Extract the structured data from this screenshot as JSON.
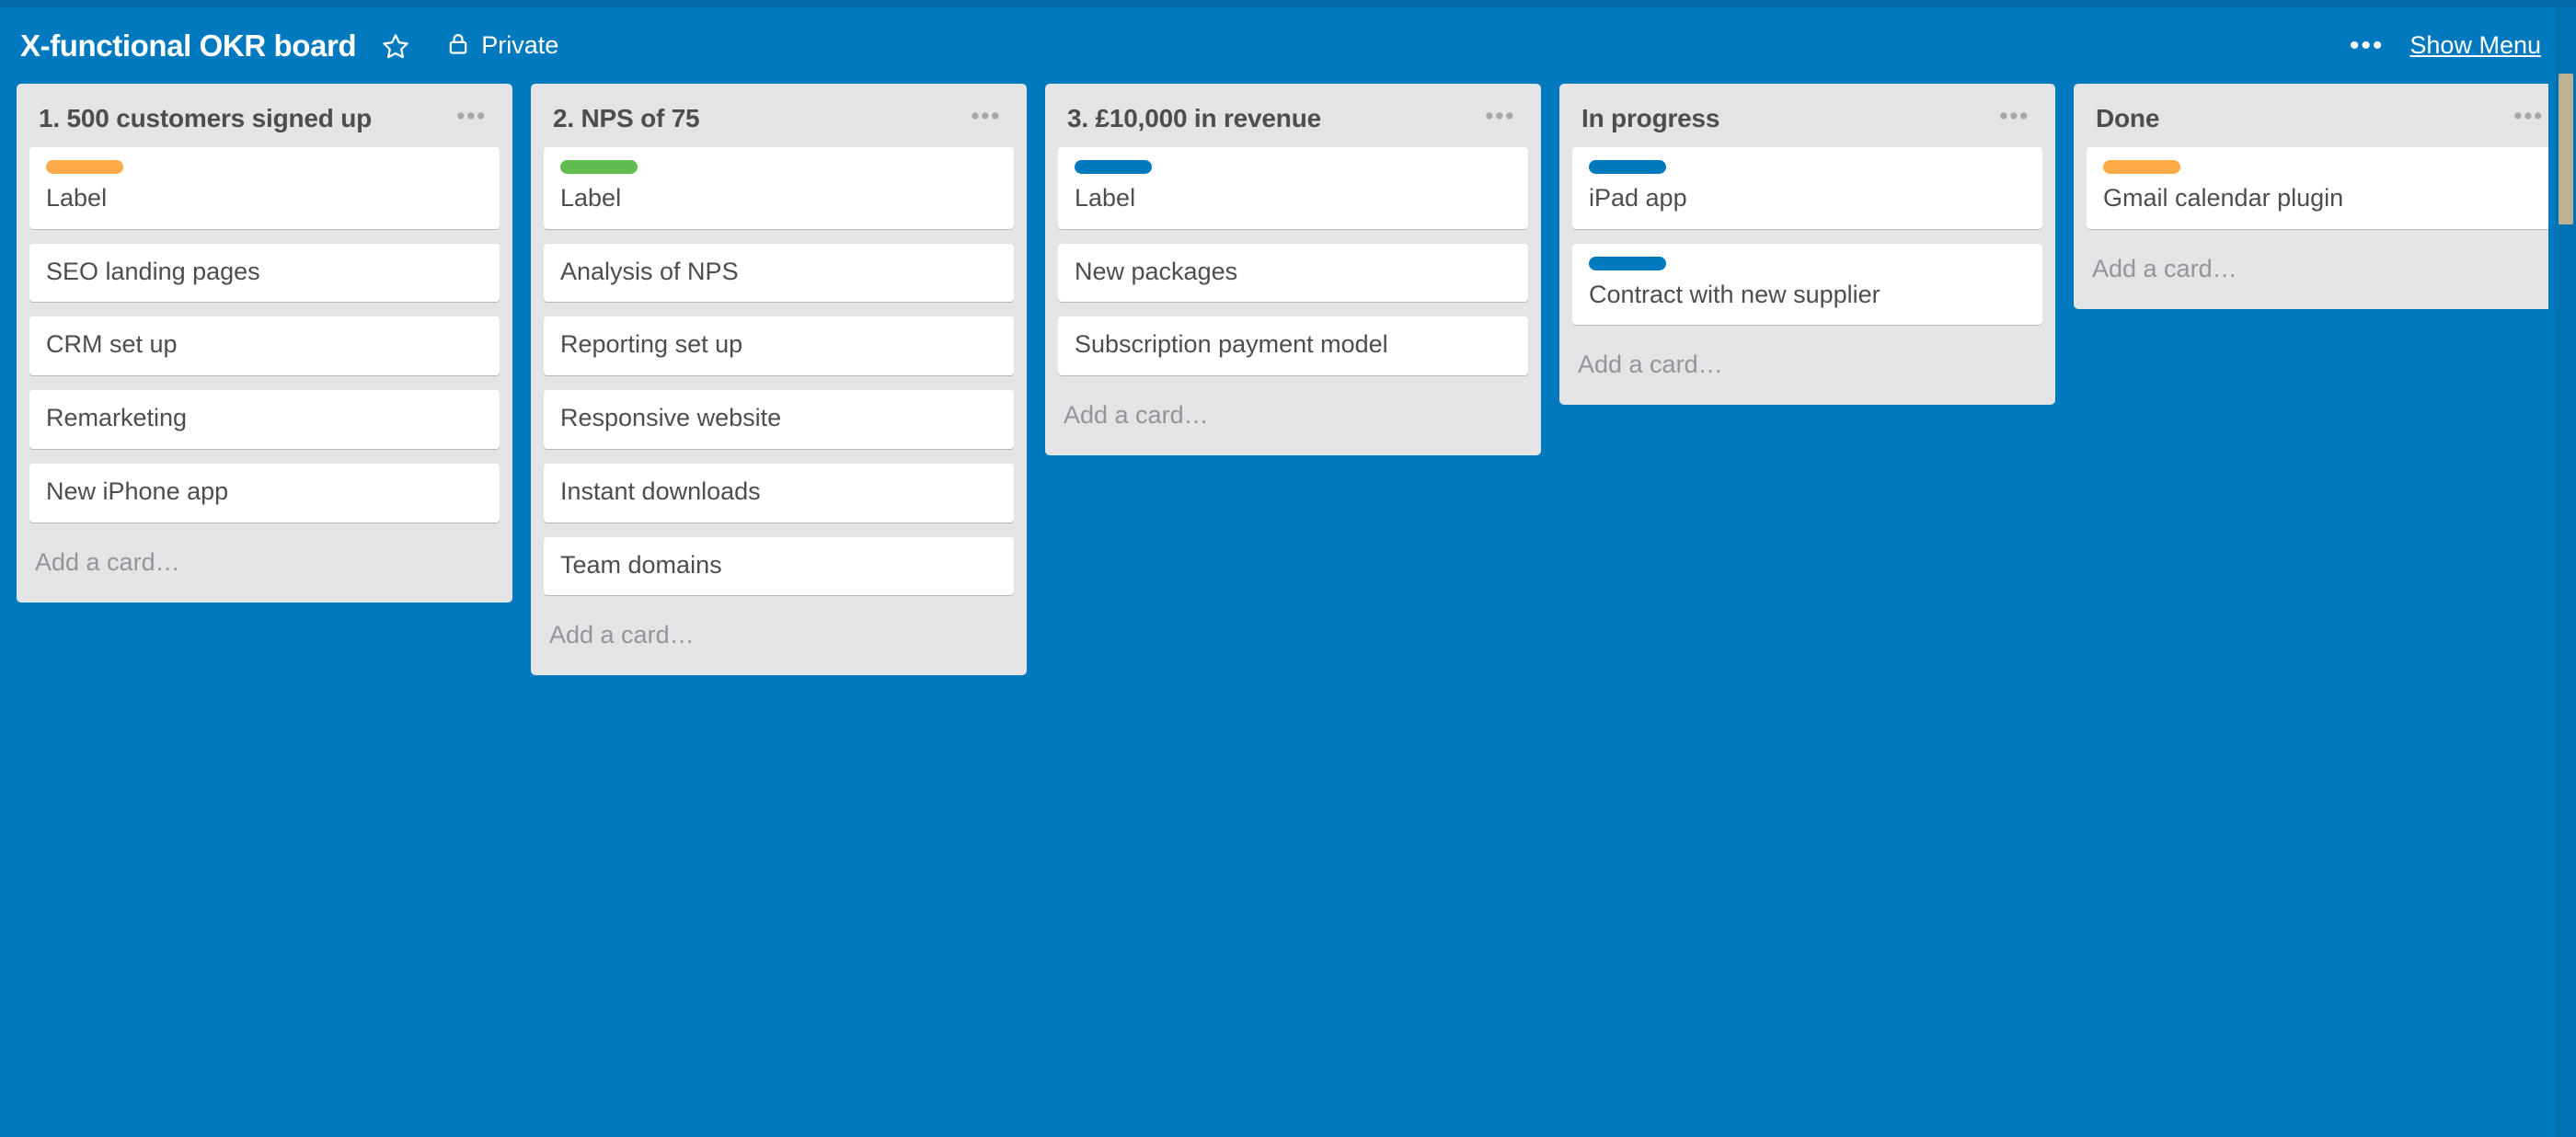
{
  "header": {
    "title": "X-functional OKR board",
    "star_icon": "star-outline-icon",
    "lock_icon": "lock-closed-icon",
    "visibility_label": "Private",
    "overflow_dots": "•••",
    "show_menu_label": "Show Menu"
  },
  "colors": {
    "board_background": "#0079bf",
    "top_strip": "#026aa7",
    "list_background": "#e2e4e6",
    "card_background": "#ffffff",
    "text": "#4d4d4d",
    "muted_text": "#929599",
    "label_orange": "#ffab4a",
    "label_green": "#61bd4f",
    "label_blue": "#0079bf",
    "scrollbar_thumb": "#bdb192"
  },
  "lists": [
    {
      "title": "1. 500 customers signed up",
      "menu_dots": "•••",
      "add_card_label": "Add a card…",
      "cards": [
        {
          "title": "Label",
          "labels": [
            "#ffab4a"
          ]
        },
        {
          "title": "SEO landing pages",
          "labels": []
        },
        {
          "title": "CRM set up",
          "labels": []
        },
        {
          "title": "Remarketing",
          "labels": []
        },
        {
          "title": "New iPhone app",
          "labels": []
        }
      ]
    },
    {
      "title": "2. NPS of 75",
      "menu_dots": "•••",
      "add_card_label": "Add a card…",
      "cards": [
        {
          "title": "Label",
          "labels": [
            "#61bd4f"
          ]
        },
        {
          "title": "Analysis of NPS",
          "labels": []
        },
        {
          "title": "Reporting set up",
          "labels": []
        },
        {
          "title": "Responsive website",
          "labels": []
        },
        {
          "title": "Instant downloads",
          "labels": []
        },
        {
          "title": "Team domains",
          "labels": []
        }
      ]
    },
    {
      "title": "3. £10,000 in revenue",
      "menu_dots": "•••",
      "add_card_label": "Add a card…",
      "cards": [
        {
          "title": "Label",
          "labels": [
            "#0079bf"
          ]
        },
        {
          "title": "New packages",
          "labels": []
        },
        {
          "title": "Subscription payment model",
          "labels": []
        }
      ]
    },
    {
      "title": "In progress",
      "menu_dots": "•••",
      "add_card_label": "Add a card…",
      "cards": [
        {
          "title": "iPad app",
          "labels": [
            "#0079bf"
          ]
        },
        {
          "title": "Contract with new supplier",
          "labels": [
            "#0079bf"
          ]
        }
      ]
    },
    {
      "title": "Done",
      "menu_dots": "•••",
      "add_card_label": "Add a card…",
      "cards": [
        {
          "title": "Gmail calendar plugin",
          "labels": [
            "#ffab4a"
          ]
        }
      ]
    }
  ]
}
